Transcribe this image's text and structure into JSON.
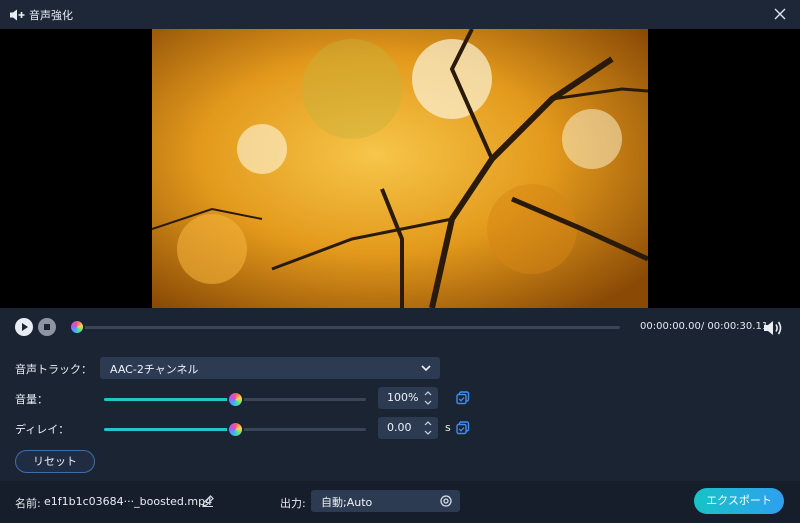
{
  "window": {
    "title": "音声強化",
    "app_icon": "speaker-plus-icon",
    "close_icon": "close-icon"
  },
  "player": {
    "time_display": "00:00:00.00/ 00:00:30.11",
    "progress": 0.0,
    "play_icon": "play-icon",
    "stop_icon": "stop-icon",
    "volume_icon": "volume-icon"
  },
  "audio_track": {
    "label": "音声トラック：",
    "value": "AAC-2チャンネル"
  },
  "volume": {
    "label": "音量：",
    "value": "100%",
    "slider_fraction": 0.5
  },
  "delay": {
    "label": "ディレイ：",
    "value": "0.00",
    "unit": "s",
    "slider_fraction": 0.5
  },
  "reset_label": "リセット",
  "footer": {
    "name_label": "名前:",
    "filename": "e1f1b1c03684···_boosted.mp4",
    "output_label": "出力:",
    "output_value": "自動;Auto",
    "export_label": "エクスポート"
  },
  "colors": {
    "accent": "#23c6c8",
    "background": "#1b2433",
    "export_gradient_end": "#2f9ff0"
  }
}
